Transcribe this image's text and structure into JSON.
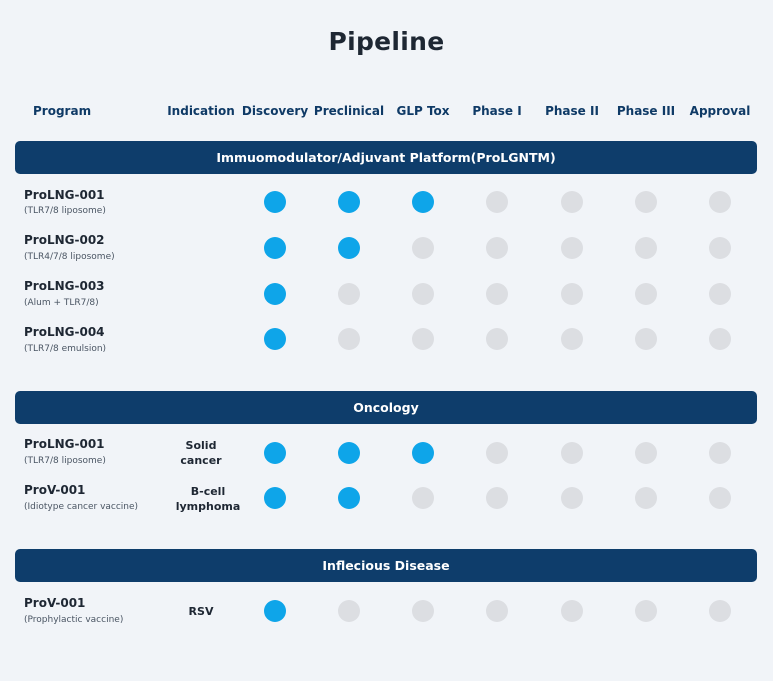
{
  "page": {
    "title": "Pipeline"
  },
  "colors": {
    "active": "#0ea5e9",
    "inactive": "#dcdee2",
    "bar": "#0e3d6b"
  },
  "columns": {
    "program": "Program",
    "indication": "Indication",
    "stages": [
      "Discovery",
      "Preclinical",
      "GLP Tox",
      "Phase I",
      "Phase II",
      "Phase III",
      "Approval"
    ]
  },
  "sections": [
    {
      "title": "Immuomodulator/Adjuvant Platform(ProLGNTM)",
      "programs": [
        {
          "name": "ProLNG-001",
          "sub": "(TLR7/8 liposome)",
          "indication": "",
          "stages_completed": 3
        },
        {
          "name": "ProLNG-002",
          "sub": "(TLR4/7/8 liposome)",
          "indication": "",
          "stages_completed": 2
        },
        {
          "name": "ProLNG-003",
          "sub": "(Alum + TLR7/8)",
          "indication": "",
          "stages_completed": 1
        },
        {
          "name": "ProLNG-004",
          "sub": "(TLR7/8 emulsion)",
          "indication": "",
          "stages_completed": 1
        }
      ]
    },
    {
      "title": "Oncology",
      "programs": [
        {
          "name": "ProLNG-001",
          "sub": "(TLR7/8 liposome)",
          "indication": [
            "Solid",
            "cancer"
          ],
          "stages_completed": 3
        },
        {
          "name": "ProV-001",
          "sub": "(Idiotype cancer vaccine)",
          "indication": [
            "B-cell",
            "lymphoma"
          ],
          "stages_completed": 2
        }
      ]
    },
    {
      "title": "Inflecious Disease",
      "programs": [
        {
          "name": "ProV-001",
          "sub": "(Prophylactic vaccine)",
          "indication": [
            "RSV"
          ],
          "stages_completed": 1
        }
      ]
    }
  ],
  "chart_data": {
    "type": "table",
    "title": "Pipeline",
    "columns": [
      "Program",
      "Indication",
      "Discovery",
      "Preclinical",
      "GLP Tox",
      "Phase I",
      "Phase II",
      "Phase III",
      "Approval"
    ],
    "rows": [
      {
        "section": "Immuomodulator/Adjuvant Platform(ProLGNTM)",
        "program": "ProLNG-001",
        "indication": "",
        "stages_completed": 3
      },
      {
        "section": "Immuomodulator/Adjuvant Platform(ProLGNTM)",
        "program": "ProLNG-002",
        "indication": "",
        "stages_completed": 2
      },
      {
        "section": "Immuomodulator/Adjuvant Platform(ProLGNTM)",
        "program": "ProLNG-003",
        "indication": "",
        "stages_completed": 1
      },
      {
        "section": "Immuomodulator/Adjuvant Platform(ProLGNTM)",
        "program": "ProLNG-004",
        "indication": "",
        "stages_completed": 1
      },
      {
        "section": "Oncology",
        "program": "ProLNG-001",
        "indication": "Solid cancer",
        "stages_completed": 3
      },
      {
        "section": "Oncology",
        "program": "ProV-001",
        "indication": "B-cell lymphoma",
        "stages_completed": 2
      },
      {
        "section": "Inflecious Disease",
        "program": "ProV-001",
        "indication": "RSV",
        "stages_completed": 1
      }
    ]
  }
}
